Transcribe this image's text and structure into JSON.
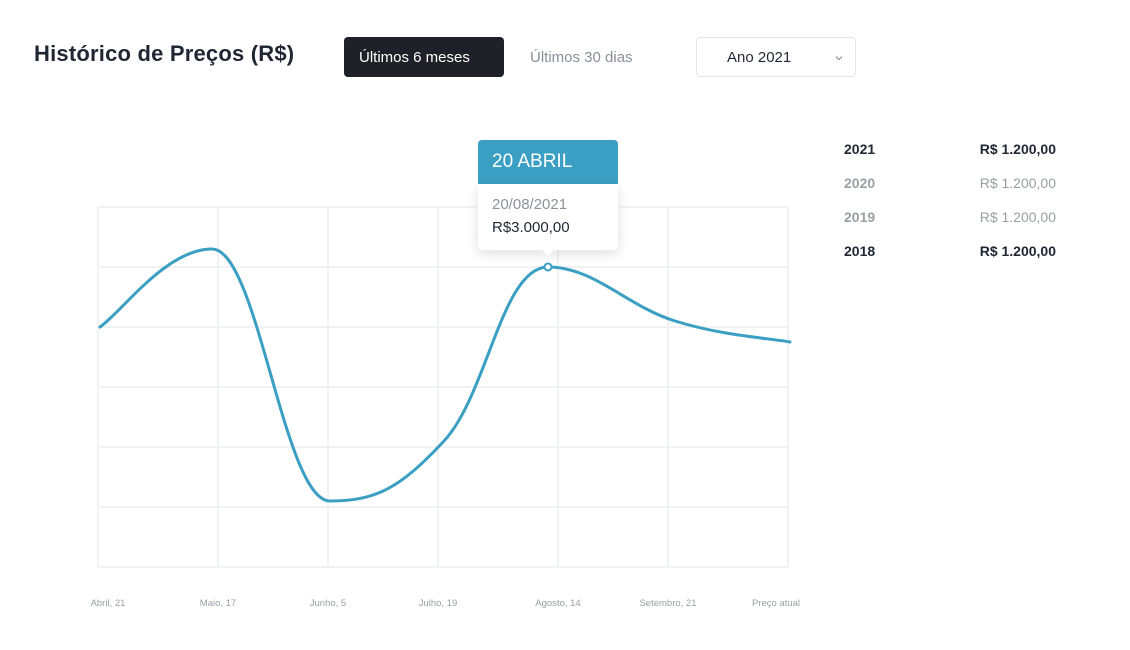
{
  "header": {
    "title": "Histórico de Preços (R$)",
    "tab_active": "Últimos 6 meses",
    "tab_inactive": "Últimos 30 dias",
    "year_select": "Ano 2021"
  },
  "tooltip": {
    "heading": "20 ABRIL",
    "date": "20/08/2021",
    "price": "R$3.000,00"
  },
  "legend": [
    {
      "year": "2021",
      "value": "R$ 1.200,00",
      "emphasis": true
    },
    {
      "year": "2020",
      "value": "R$ 1.200,00",
      "emphasis": false
    },
    {
      "year": "2019",
      "value": "R$ 1.200,00",
      "emphasis": false
    },
    {
      "year": "2018",
      "value": "R$ 1.200,00",
      "emphasis": true
    }
  ],
  "colors": {
    "line": "#3a9fc2",
    "grid": "#eceef0",
    "active_button": "#1f2028"
  },
  "chart_data": {
    "type": "line",
    "categories": [
      "Abril, 21",
      "Maio, 17",
      "Junho, 5",
      "Julho, 19",
      "Agosto, 14",
      "Setembro, 21",
      "Preço atual"
    ],
    "series": [
      {
        "values": [
          4.0,
          5.3,
          1.1,
          2.1,
          5.0,
          4.1,
          3.75
        ]
      }
    ],
    "highlight_index": 4,
    "ylim": [
      0,
      6
    ],
    "grid": true
  }
}
